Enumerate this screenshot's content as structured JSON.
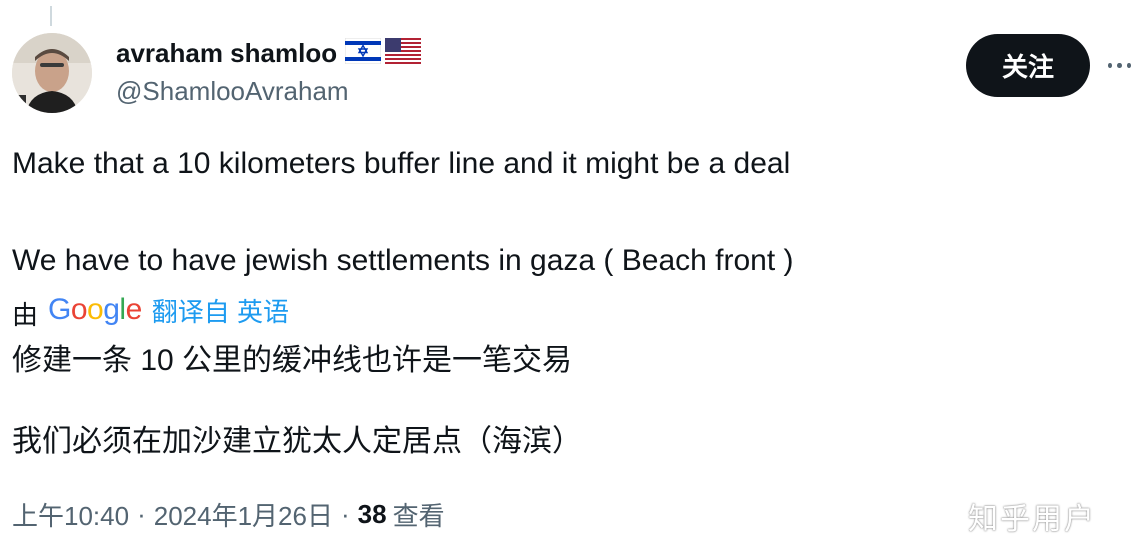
{
  "author": {
    "display_name": "avraham shamloo",
    "handle": "@ShamlooAvraham",
    "flags": [
      "israel-flag-icon",
      "us-flag-icon"
    ]
  },
  "follow_button": {
    "label": "关注"
  },
  "tweet": {
    "line1": "Make that a 10 kilometers buffer line and it might be a deal",
    "line2": "We have to have jewish settlements in gaza ( Beach front )"
  },
  "translation": {
    "prefix": "由",
    "provider": "Google",
    "link_text": "翻译自 英语",
    "line1": "修建一条 10 公里的缓冲线也许是一笔交易",
    "line2": "我们必须在加沙建立犹太人定居点（海滨）"
  },
  "meta": {
    "time": "上午10:40",
    "date": "2024年1月26日",
    "views_count": "38",
    "views_label": "查看"
  },
  "watermark": "知乎用户",
  "colors": {
    "text": "#0f1419",
    "secondary": "#536471",
    "link": "#1d9bf0",
    "button_bg": "#0f1419"
  }
}
